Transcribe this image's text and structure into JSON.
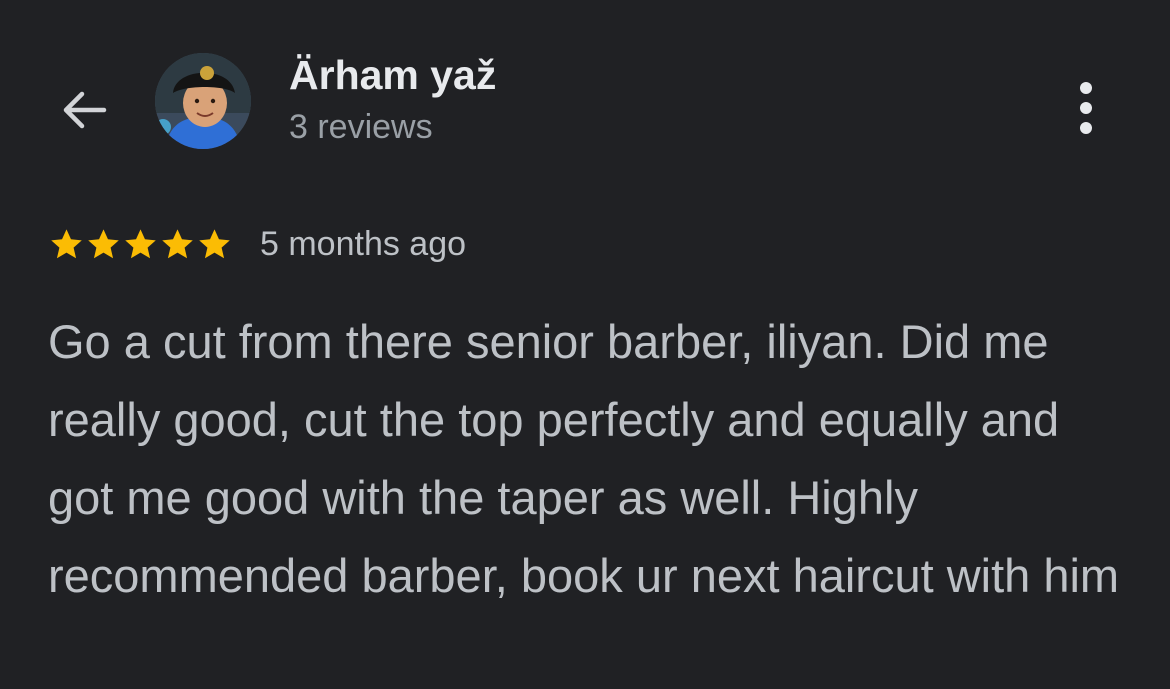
{
  "header": {
    "back_icon": "arrow-left-icon",
    "author_name": "Ärham yaž",
    "review_count": "3 reviews",
    "more_icon": "more-vertical-icon"
  },
  "review": {
    "rating": 5,
    "rating_max": 5,
    "star_color": "#fbbc04",
    "time": "5 months ago",
    "text": "Go a cut from there senior barber, iliyan. Did me really good, cut the top perfectly and equally and got me good with the taper as well. Highly recommended barber, book ur next haircut with him"
  },
  "colors": {
    "background": "#202124",
    "primary_text": "#e8eaed",
    "secondary_text": "#9aa0a6",
    "body_text": "#bdc1c6"
  }
}
